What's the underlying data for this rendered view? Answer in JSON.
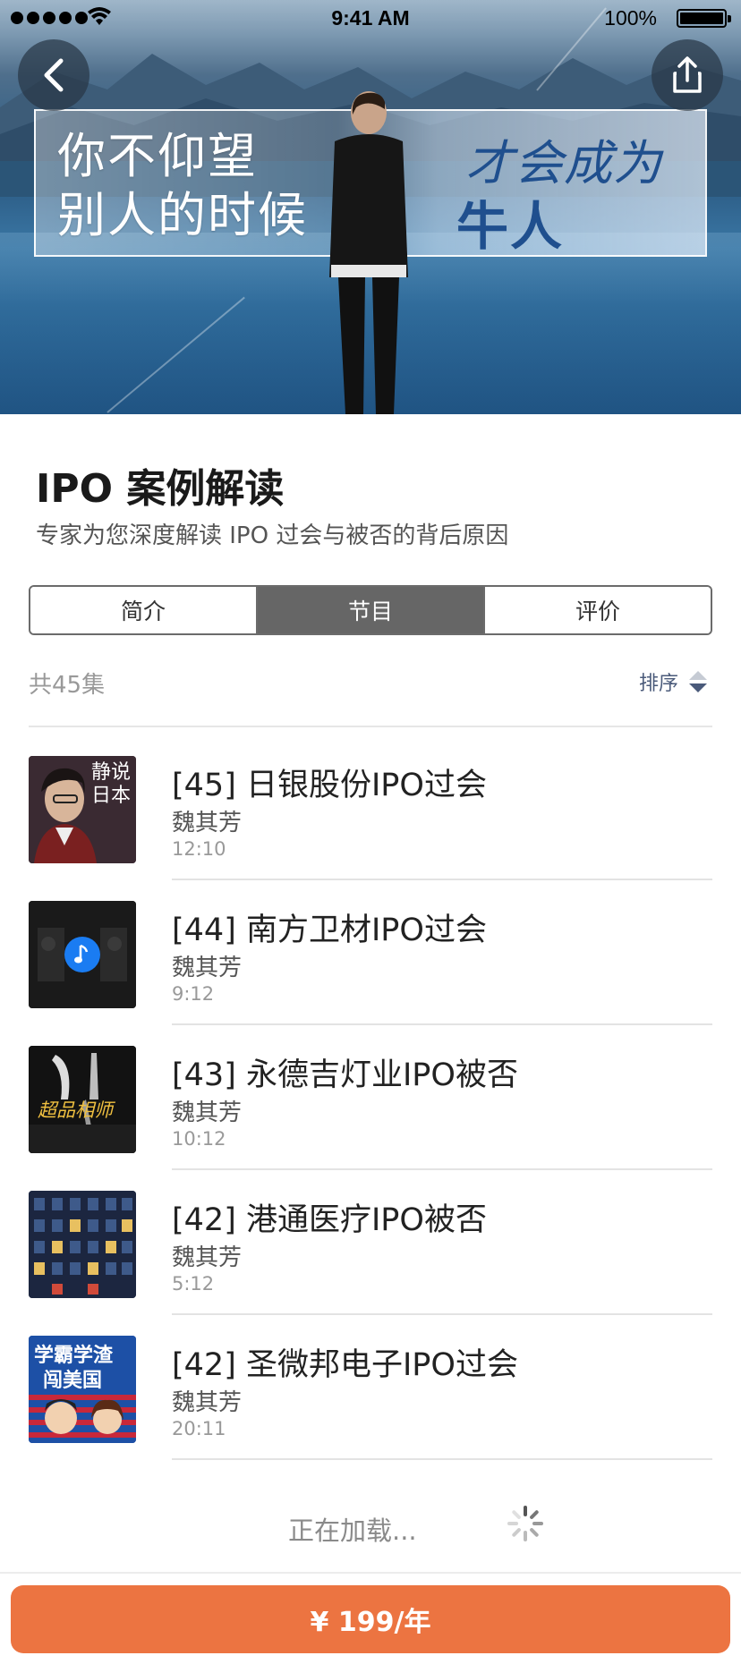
{
  "status_bar": {
    "time": "9:41 AM",
    "battery": "100%"
  },
  "hero": {
    "banner_left": "你不仰望\n别人的时候",
    "banner_right_1": "才会成为",
    "banner_right_2": "牛人"
  },
  "course": {
    "title": "IPO 案例解读",
    "subtitle": "专家为您深度解读 IPO 过会与被否的背后原因"
  },
  "tabs": [
    {
      "label": "简介",
      "active": false
    },
    {
      "label": "节目",
      "active": true
    },
    {
      "label": "评价",
      "active": false
    }
  ],
  "list_header": {
    "count": "共45集",
    "sort_label": "排序"
  },
  "episodes": [
    {
      "title": "[45] 日银股份IPO过会",
      "author": "魏其芳",
      "duration": "12:10"
    },
    {
      "title": "[44] 南方卫材IPO过会",
      "author": "魏其芳",
      "duration": "9:12"
    },
    {
      "title": "[43] 永德吉灯业IPO被否",
      "author": "魏其芳",
      "duration": "10:12"
    },
    {
      "title": "[42] 港通医疗IPO被否",
      "author": "魏其芳",
      "duration": "5:12"
    },
    {
      "title": "[42] 圣微邦电子IPO过会",
      "author": "魏其芳",
      "duration": "20:11"
    }
  ],
  "thumb_text": {
    "t1": "静说日本",
    "t3": "超品相师",
    "t5_line1": "学霸学渣",
    "t5_line2": "闯美国"
  },
  "loading_text": "正在加载...",
  "buy_button": "¥ 199/年",
  "colors": {
    "accent": "#ec7441",
    "active_tab": "#666666",
    "sort": "#4a5a7a",
    "play_badge": "#1a7cf2"
  }
}
